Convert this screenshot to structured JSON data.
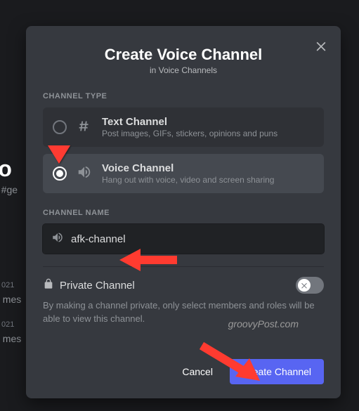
{
  "background": {
    "big_text": "e to",
    "sub_text": "e #ge",
    "date1": "021",
    "msg1": "t mes",
    "date2": "021",
    "msg2": "t mes"
  },
  "modal": {
    "title": "Create Voice Channel",
    "subtitle": "in Voice Channels",
    "channel_type_label": "Channel Type",
    "options": {
      "text": {
        "title": "Text Channel",
        "desc": "Post images, GIFs, stickers, opinions and puns"
      },
      "voice": {
        "title": "Voice Channel",
        "desc": "Hang out with voice, video and screen sharing"
      }
    },
    "channel_name_label": "Channel Name",
    "channel_name_value": "afk-channel",
    "private": {
      "title": "Private Channel",
      "desc": "By making a channel private, only select members and roles will be able to view this channel."
    },
    "buttons": {
      "cancel": "Cancel",
      "create": "Create Channel"
    }
  },
  "watermark": "groovyPost.com"
}
